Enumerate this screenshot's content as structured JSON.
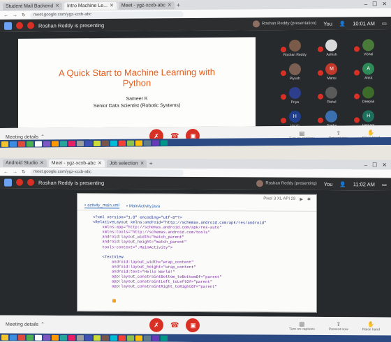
{
  "shot1": {
    "tabs": [
      {
        "label": "Student Mail Backend",
        "active": false
      },
      {
        "label": "Intro Machine Le...",
        "active": true
      },
      {
        "label": "Meet - ygz-xcxb-abc",
        "active": false
      }
    ],
    "url": "meet.google.com/ygz-xcxb-abc",
    "meeting_title": "Roshan Reddy is presenting",
    "presenter_chip": "Roshan Reddy (presentation)",
    "you_label": "You",
    "join_time": "10:01 AM",
    "slide": {
      "title": "A Quick Start to Machine Learning with Python",
      "author": "Sameer K",
      "role": "Senior Data Scientist (Robotic Systems)"
    },
    "participants": [
      {
        "initial": "",
        "name": "Roshan Reddy",
        "color": "#7a5a48"
      },
      {
        "initial": "",
        "name": "Ashish",
        "color": "#d9d9d9"
      },
      {
        "initial": "",
        "name": "Vishal",
        "color": "#4a7a3a"
      },
      {
        "initial": "",
        "name": "Piyush",
        "color": "#7b5f52"
      },
      {
        "initial": "M",
        "name": "Mansi",
        "color": "#c0392b"
      },
      {
        "initial": "A",
        "name": "Ankit",
        "color": "#2e8b57"
      },
      {
        "initial": "",
        "name": "Priya",
        "color": "#2c3e8c"
      },
      {
        "initial": "",
        "name": "Rahul",
        "color": "#5a5a5a"
      },
      {
        "initial": "",
        "name": "Deepak",
        "color": "#3d6b2a"
      },
      {
        "initial": "H",
        "name": "Harsh",
        "color": "#1f3f8c"
      },
      {
        "initial": "",
        "name": "Sneha",
        "color": "#3a6fb0"
      },
      {
        "initial": "H",
        "name": "Hemant",
        "color": "#1f6f5f"
      }
    ],
    "controls": {
      "present_label": "Meeting details",
      "right": [
        "Turn on captions",
        "Present now",
        "Raise hand"
      ]
    }
  },
  "shot2": {
    "tabs": [
      {
        "label": "Android Studio",
        "active": false
      },
      {
        "label": "Meet - ygz-xcxb-abc",
        "active": true
      },
      {
        "label": "Job selection",
        "active": false
      }
    ],
    "url": "meet.google.com/ygz-xcxb-abc",
    "meeting_title": "Roshan Reddy is presenting",
    "presenter_chip": "Roshan Reddy (presenting)",
    "you_label": "You",
    "join_time": "11:02 AM",
    "editor": {
      "device_label": "Pixel 3 XL API 29",
      "tabs": [
        "activity_main.xml",
        "MainActivity.java"
      ],
      "code_lines": [
        {
          "text": "<?xml version=\"1.0\" encoding=\"utf-8\"?>",
          "kind": "tag"
        },
        {
          "text": "<RelativeLayout xmlns:android=\"http://schemas.android.com/apk/res/android\"",
          "kind": "tag"
        },
        {
          "text": "    xmlns:app=\"http://schemas.android.com/apk/res-auto\"",
          "kind": "attr"
        },
        {
          "text": "    xmlns:tools=\"http://schemas.android.com/tools\"",
          "kind": "attr"
        },
        {
          "text": "    android:layout_width=\"match_parent\"",
          "kind": "attr"
        },
        {
          "text": "    android:layout_height=\"match_parent\"",
          "kind": "attr"
        },
        {
          "text": "    tools:context=\".MainActivity\">",
          "kind": "attr"
        },
        {
          "text": "",
          "kind": "blank"
        },
        {
          "text": "    <TextView",
          "kind": "tag"
        },
        {
          "text": "        android:layout_width=\"wrap_content\"",
          "kind": "attr"
        },
        {
          "text": "        android:layout_height=\"wrap_content\"",
          "kind": "attr"
        },
        {
          "text": "        android:text=\"Hello World!\"",
          "kind": "attr"
        },
        {
          "text": "        app:layout_constraintBottom_toBottomOf=\"parent\"",
          "kind": "attr"
        },
        {
          "text": "        app:layout_constraintLeft_toLeftOf=\"parent\"",
          "kind": "attr"
        },
        {
          "text": "        app:layout_constraintRight_toRightOf=\"parent\"",
          "kind": "attr"
        }
      ]
    },
    "controls": {
      "present_label": "Meeting details",
      "right": [
        "Turn on captions",
        "Present now",
        "Raise hand"
      ]
    }
  },
  "colors": {
    "red": "#d93025",
    "meet_dark": "#2c2e30",
    "slide_title": "#e65e1f",
    "taskbar": "#2b4a83"
  },
  "icons": [
    "mic-off-icon",
    "hang-up-icon",
    "camera-off-icon",
    "captions-icon",
    "present-icon",
    "hand-icon",
    "user-icon"
  ]
}
